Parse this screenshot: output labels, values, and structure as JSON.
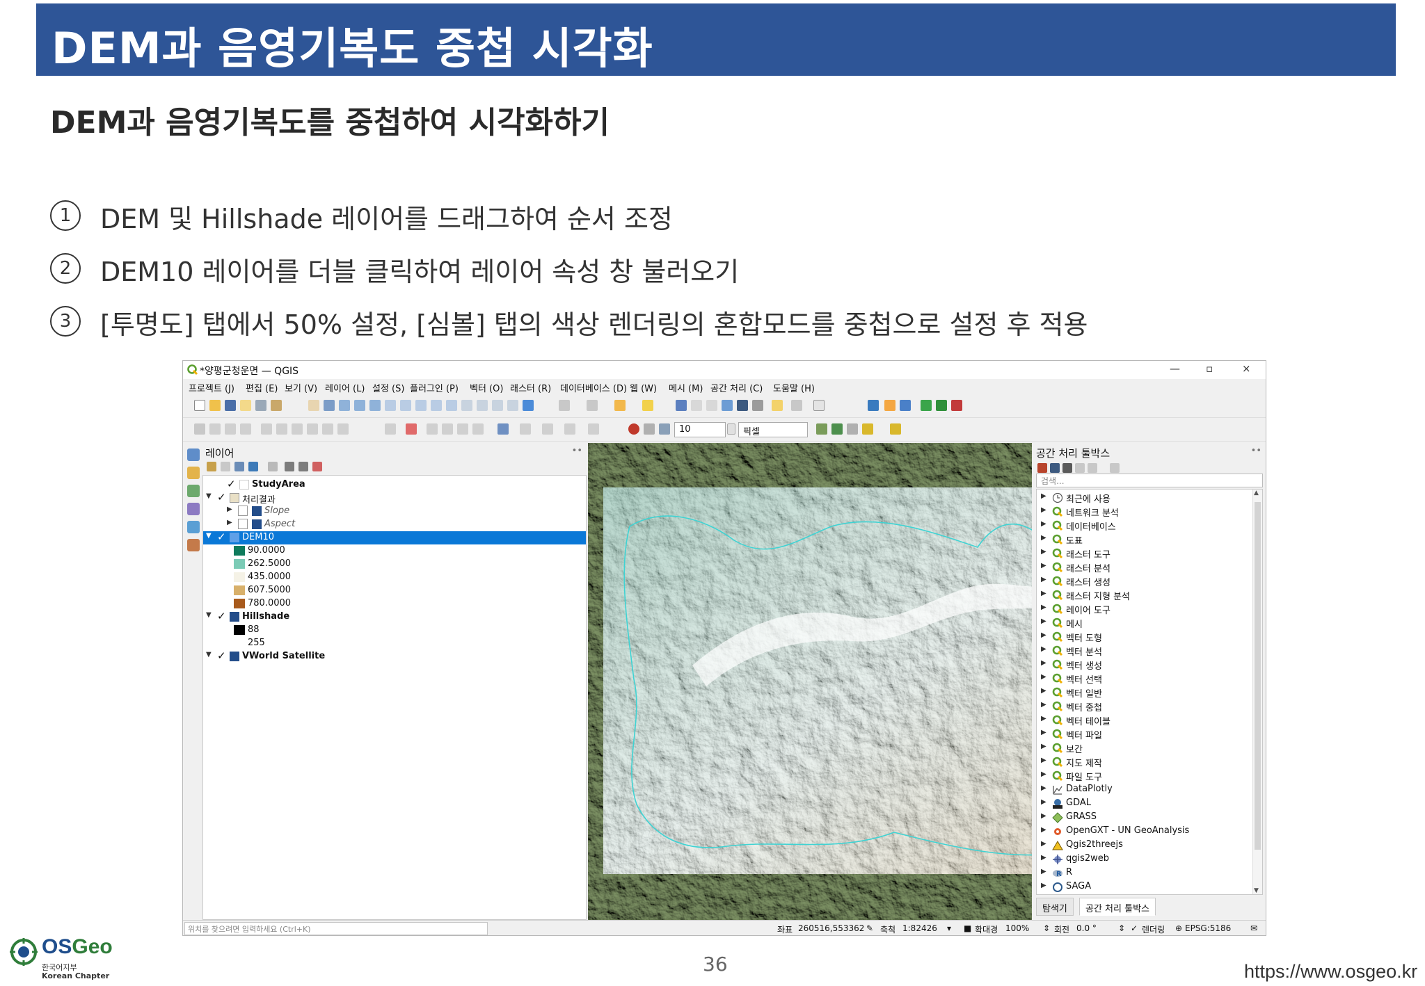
{
  "slide": {
    "title": "DEM과 음영기복도 중첩 시각화",
    "subtitle": "DEM과 음영기복도를 중첩하여 시각화하기",
    "steps": [
      {
        "num": "1",
        "text": "DEM 및 Hillshade 레이어를 드래그하여 순서 조정"
      },
      {
        "num": "2",
        "text": "DEM10 레이어를 더블 클릭하여 레이어 속성 창 불러오기"
      },
      {
        "num": "3",
        "text": "[투명도] 탭에서 50% 설정, [심볼] 탭의 색상 렌더링의 혼합모드를 중첩으로 설정 후 적용"
      }
    ],
    "page_number": "36",
    "footer_url": "https://www.osgeo.kr",
    "logo": {
      "name": "OSGeo",
      "name_a": "OS",
      "name_b": "Geo",
      "sub1": "한국어지부",
      "sub2": "Korean Chapter"
    }
  },
  "qgis": {
    "window_title": "*양평군청운면 — QGIS",
    "window_controls": {
      "minimize": "—",
      "maximize": "▫",
      "close": "×"
    },
    "menu": [
      "프로젝트 (J)",
      "편집 (E)",
      "보기 (V)",
      "레이어 (L)",
      "설정 (S)",
      "플러그인 (P)",
      "벡터 (O)",
      "래스터 (R)",
      "데이터베이스 (D)",
      "웹 (W)",
      "메시 (M)",
      "공간 처리 (C)",
      "도움말 (H)"
    ],
    "toolbar2": {
      "size_value": "10",
      "unit_value": "픽셀"
    },
    "layers_panel": {
      "title": "레이어",
      "rows": [
        {
          "label": "StudyArea",
          "bold": true
        },
        {
          "label": "처리결과",
          "bold": false
        },
        {
          "label": "Slope",
          "italic": true
        },
        {
          "label": "Aspect",
          "italic": true
        },
        {
          "label": "DEM10",
          "selected": true
        },
        {
          "label": "90.0000",
          "swatch": "#0f7b5c"
        },
        {
          "label": "262.5000",
          "swatch": "#7ccbb6"
        },
        {
          "label": "435.0000",
          "swatch": "#f5f2e6"
        },
        {
          "label": "607.5000",
          "swatch": "#d8b06a"
        },
        {
          "label": "780.0000",
          "swatch": "#a85a1c"
        },
        {
          "label": "Hillshade",
          "bold": true
        },
        {
          "label": "88",
          "swatch": "#000000"
        },
        {
          "label": "255",
          "swatch": "#ffffff"
        },
        {
          "label": "VWorld Satellite",
          "bold": true
        }
      ]
    },
    "toolbox": {
      "title": "공간 처리 툴박스",
      "search_placeholder": "검색...",
      "items": [
        "최근에 사용",
        "네트워크 분석",
        "데이터베이스",
        "도표",
        "래스터 도구",
        "래스터 분석",
        "래스터 생성",
        "래스터 지형 분석",
        "레이어 도구",
        "메시",
        "벡터 도형",
        "벡터 분석",
        "벡터 생성",
        "벡터 선택",
        "벡터 일반",
        "벡터 중첩",
        "벡터 테이블",
        "벡터 파일",
        "보간",
        "지도 제작",
        "파일 도구",
        "DataPlotly",
        "GDAL",
        "GRASS",
        "OpenGXT - UN GeoAnalysis",
        "Qgis2threejs",
        "qgis2web",
        "R",
        "SAGA"
      ],
      "tabs": [
        "탐색기",
        "공간 처리 툴박스"
      ]
    },
    "statusbar": {
      "locate_placeholder": "위치를 찾으려면 입력하세요 (Ctrl+K)",
      "coord_label": "좌표",
      "coord_value": "260516,553362",
      "scale_label": "축척",
      "scale_value": "1:82426",
      "magnifier_label": "확대경",
      "magnifier_value": "100%",
      "rotation_label": "회전",
      "rotation_value": "0.0 °",
      "render_label": "렌더링",
      "crs": "EPSG:5186"
    }
  }
}
